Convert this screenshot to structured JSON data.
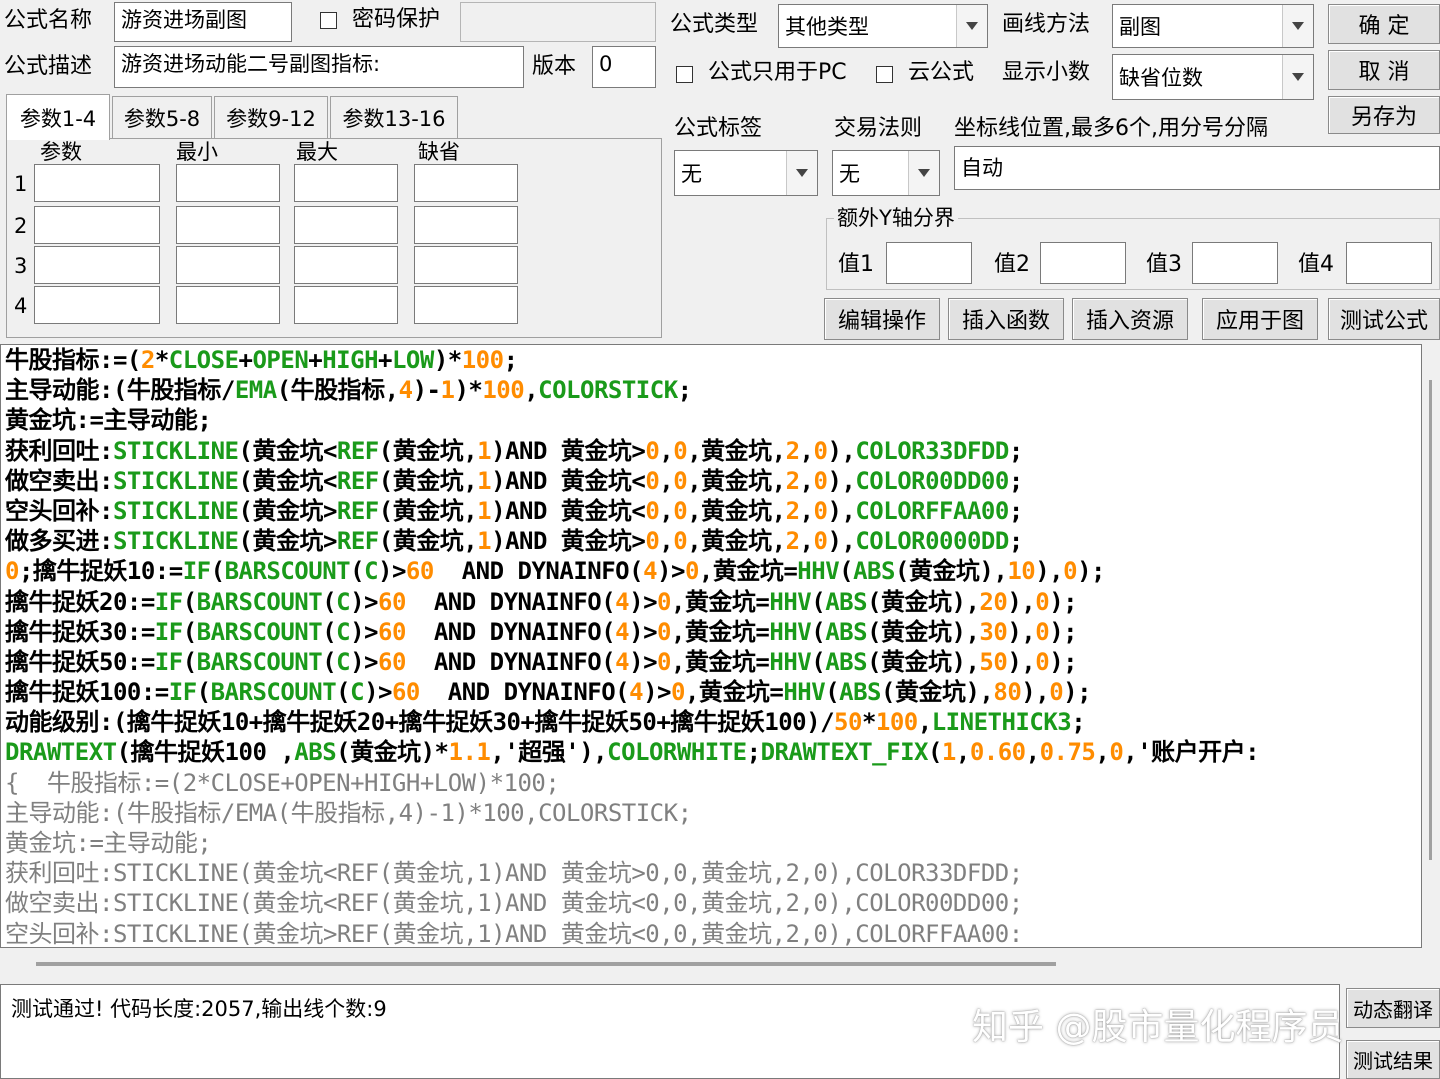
{
  "header": {
    "name_label": "公式名称",
    "name_value": "游资进场副图",
    "password_label": "密码保护",
    "password_checked": false,
    "desc_label": "公式描述",
    "desc_value": "游资进场动能二号副图指标:",
    "version_label": "版本",
    "version_value": "0",
    "type_label": "公式类型",
    "type_value": "其他类型",
    "draw_label": "画线方法",
    "draw_value": "副图",
    "pc_only_label": "公式只用于PC",
    "pc_only_checked": false,
    "cloud_label": "云公式",
    "cloud_checked": false,
    "decimals_label": "显示小数",
    "decimals_value": "缺省位数"
  },
  "buttons": {
    "ok": "确 定",
    "cancel": "取 消",
    "save_as": "另存为",
    "edit_ops": "编辑操作",
    "insert_func": "插入函数",
    "insert_res": "插入资源",
    "apply_chart": "应用于图",
    "test_formula": "测试公式",
    "translate": "动态翻译",
    "test_result": "测试结果"
  },
  "tabs": [
    "参数1-4",
    "参数5-8",
    "参数9-12",
    "参数13-16"
  ],
  "params": {
    "col_headers": [
      "参数",
      "最小",
      "最大",
      "缺省"
    ],
    "rows": [
      "1",
      "2",
      "3",
      "4"
    ]
  },
  "right_panel": {
    "tag_label": "公式标签",
    "tag_value": "无",
    "rule_label": "交易法则",
    "rule_value": "无",
    "axis_label": "坐标线位置,最多6个,用分号分隔",
    "axis_value": "自动",
    "yaxis_group": "额外Y轴分界",
    "v1": "值1",
    "v2": "值2",
    "v3": "值3",
    "v4": "值4"
  },
  "code_lines": [
    [
      [
        "t",
        "牛股指标:=("
      ],
      [
        "n",
        "2"
      ],
      [
        "t",
        "*"
      ],
      [
        "f",
        "CLOSE"
      ],
      [
        "t",
        "+"
      ],
      [
        "f",
        "OPEN"
      ],
      [
        "t",
        "+"
      ],
      [
        "f",
        "HIGH"
      ],
      [
        "t",
        "+"
      ],
      [
        "f",
        "LOW"
      ],
      [
        "t",
        ")*"
      ],
      [
        "n",
        "100"
      ],
      [
        "t",
        ";"
      ]
    ],
    [
      [
        "t",
        "主导动能:(牛股指标/"
      ],
      [
        "f",
        "EMA"
      ],
      [
        "t",
        "(牛股指标,"
      ],
      [
        "n",
        "4"
      ],
      [
        "t",
        ")-"
      ],
      [
        "n",
        "1"
      ],
      [
        "t",
        ")*"
      ],
      [
        "n",
        "100"
      ],
      [
        "t",
        ","
      ],
      [
        "f",
        "COLORSTICK"
      ],
      [
        "t",
        ";"
      ]
    ],
    [
      [
        "t",
        "黄金坑:=主导动能;"
      ]
    ],
    [
      [
        "t",
        "获利回吐:"
      ],
      [
        "f",
        "STICKLINE"
      ],
      [
        "t",
        "(黄金坑<"
      ],
      [
        "f",
        "REF"
      ],
      [
        "t",
        "(黄金坑,"
      ],
      [
        "n",
        "1"
      ],
      [
        "t",
        ")AND 黄金坑>"
      ],
      [
        "n",
        "0"
      ],
      [
        "t",
        ","
      ],
      [
        "n",
        "0"
      ],
      [
        "t",
        ",黄金坑,"
      ],
      [
        "n",
        "2"
      ],
      [
        "t",
        ","
      ],
      [
        "n",
        "0"
      ],
      [
        "t",
        "),"
      ],
      [
        "f",
        "COLOR33DFDD"
      ],
      [
        "t",
        ";"
      ]
    ],
    [
      [
        "t",
        "做空卖出:"
      ],
      [
        "f",
        "STICKLINE"
      ],
      [
        "t",
        "(黄金坑<"
      ],
      [
        "f",
        "REF"
      ],
      [
        "t",
        "(黄金坑,"
      ],
      [
        "n",
        "1"
      ],
      [
        "t",
        ")AND 黄金坑<"
      ],
      [
        "n",
        "0"
      ],
      [
        "t",
        ","
      ],
      [
        "n",
        "0"
      ],
      [
        "t",
        ",黄金坑,"
      ],
      [
        "n",
        "2"
      ],
      [
        "t",
        ","
      ],
      [
        "n",
        "0"
      ],
      [
        "t",
        "),"
      ],
      [
        "f",
        "COLOR00DD00"
      ],
      [
        "t",
        ";"
      ]
    ],
    [
      [
        "t",
        "空头回补:"
      ],
      [
        "f",
        "STICKLINE"
      ],
      [
        "t",
        "(黄金坑>"
      ],
      [
        "f",
        "REF"
      ],
      [
        "t",
        "(黄金坑,"
      ],
      [
        "n",
        "1"
      ],
      [
        "t",
        ")AND 黄金坑<"
      ],
      [
        "n",
        "0"
      ],
      [
        "t",
        ","
      ],
      [
        "n",
        "0"
      ],
      [
        "t",
        ",黄金坑,"
      ],
      [
        "n",
        "2"
      ],
      [
        "t",
        ","
      ],
      [
        "n",
        "0"
      ],
      [
        "t",
        "),"
      ],
      [
        "f",
        "COLORFFAA00"
      ],
      [
        "t",
        ";"
      ]
    ],
    [
      [
        "t",
        "做多买进:"
      ],
      [
        "f",
        "STICKLINE"
      ],
      [
        "t",
        "(黄金坑>"
      ],
      [
        "f",
        "REF"
      ],
      [
        "t",
        "(黄金坑,"
      ],
      [
        "n",
        "1"
      ],
      [
        "t",
        ")AND 黄金坑>"
      ],
      [
        "n",
        "0"
      ],
      [
        "t",
        ","
      ],
      [
        "n",
        "0"
      ],
      [
        "t",
        ",黄金坑,"
      ],
      [
        "n",
        "2"
      ],
      [
        "t",
        ","
      ],
      [
        "n",
        "0"
      ],
      [
        "t",
        "),"
      ],
      [
        "f",
        "COLOR0000DD"
      ],
      [
        "t",
        ";"
      ]
    ],
    [
      [
        "n",
        "0"
      ],
      [
        "t",
        ";擒牛捉妖10:="
      ],
      [
        "f",
        "IF"
      ],
      [
        "t",
        "("
      ],
      [
        "f",
        "BARSCOUNT"
      ],
      [
        "t",
        "("
      ],
      [
        "f",
        "C"
      ],
      [
        "t",
        ")>"
      ],
      [
        "n",
        "60"
      ],
      [
        "t",
        "  AND DYNAINFO("
      ],
      [
        "n",
        "4"
      ],
      [
        "t",
        ")>"
      ],
      [
        "n",
        "0"
      ],
      [
        "t",
        ",黄金坑="
      ],
      [
        "f",
        "HHV"
      ],
      [
        "t",
        "("
      ],
      [
        "f",
        "ABS"
      ],
      [
        "t",
        "(黄金坑),"
      ],
      [
        "n",
        "10"
      ],
      [
        "t",
        "),"
      ],
      [
        "n",
        "0"
      ],
      [
        "t",
        ");"
      ]
    ],
    [
      [
        "t",
        "擒牛捉妖20:="
      ],
      [
        "f",
        "IF"
      ],
      [
        "t",
        "("
      ],
      [
        "f",
        "BARSCOUNT"
      ],
      [
        "t",
        "("
      ],
      [
        "f",
        "C"
      ],
      [
        "t",
        ")>"
      ],
      [
        "n",
        "60"
      ],
      [
        "t",
        "  AND DYNAINFO("
      ],
      [
        "n",
        "4"
      ],
      [
        "t",
        ")>"
      ],
      [
        "n",
        "0"
      ],
      [
        "t",
        ",黄金坑="
      ],
      [
        "f",
        "HHV"
      ],
      [
        "t",
        "("
      ],
      [
        "f",
        "ABS"
      ],
      [
        "t",
        "(黄金坑),"
      ],
      [
        "n",
        "20"
      ],
      [
        "t",
        "),"
      ],
      [
        "n",
        "0"
      ],
      [
        "t",
        ");"
      ]
    ],
    [
      [
        "t",
        "擒牛捉妖30:="
      ],
      [
        "f",
        "IF"
      ],
      [
        "t",
        "("
      ],
      [
        "f",
        "BARSCOUNT"
      ],
      [
        "t",
        "("
      ],
      [
        "f",
        "C"
      ],
      [
        "t",
        ")>"
      ],
      [
        "n",
        "60"
      ],
      [
        "t",
        "  AND DYNAINFO("
      ],
      [
        "n",
        "4"
      ],
      [
        "t",
        ")>"
      ],
      [
        "n",
        "0"
      ],
      [
        "t",
        ",黄金坑="
      ],
      [
        "f",
        "HHV"
      ],
      [
        "t",
        "("
      ],
      [
        "f",
        "ABS"
      ],
      [
        "t",
        "(黄金坑),"
      ],
      [
        "n",
        "30"
      ],
      [
        "t",
        "),"
      ],
      [
        "n",
        "0"
      ],
      [
        "t",
        ");"
      ]
    ],
    [
      [
        "t",
        "擒牛捉妖50:="
      ],
      [
        "f",
        "IF"
      ],
      [
        "t",
        "("
      ],
      [
        "f",
        "BARSCOUNT"
      ],
      [
        "t",
        "("
      ],
      [
        "f",
        "C"
      ],
      [
        "t",
        ")>"
      ],
      [
        "n",
        "60"
      ],
      [
        "t",
        "  AND DYNAINFO("
      ],
      [
        "n",
        "4"
      ],
      [
        "t",
        ")>"
      ],
      [
        "n",
        "0"
      ],
      [
        "t",
        ",黄金坑="
      ],
      [
        "f",
        "HHV"
      ],
      [
        "t",
        "("
      ],
      [
        "f",
        "ABS"
      ],
      [
        "t",
        "(黄金坑),"
      ],
      [
        "n",
        "50"
      ],
      [
        "t",
        "),"
      ],
      [
        "n",
        "0"
      ],
      [
        "t",
        ");"
      ]
    ],
    [
      [
        "t",
        "擒牛捉妖100:="
      ],
      [
        "f",
        "IF"
      ],
      [
        "t",
        "("
      ],
      [
        "f",
        "BARSCOUNT"
      ],
      [
        "t",
        "("
      ],
      [
        "f",
        "C"
      ],
      [
        "t",
        ")>"
      ],
      [
        "n",
        "60"
      ],
      [
        "t",
        "  AND DYNAINFO("
      ],
      [
        "n",
        "4"
      ],
      [
        "t",
        ")>"
      ],
      [
        "n",
        "0"
      ],
      [
        "t",
        ",黄金坑="
      ],
      [
        "f",
        "HHV"
      ],
      [
        "t",
        "("
      ],
      [
        "f",
        "ABS"
      ],
      [
        "t",
        "(黄金坑),"
      ],
      [
        "n",
        "80"
      ],
      [
        "t",
        "),"
      ],
      [
        "n",
        "0"
      ],
      [
        "t",
        ");"
      ]
    ],
    [
      [
        "t",
        "动能级别:(擒牛捉妖10+擒牛捉妖20+擒牛捉妖30+擒牛捉妖50+擒牛捉妖100)/"
      ],
      [
        "n",
        "50"
      ],
      [
        "t",
        "*"
      ],
      [
        "n",
        "100"
      ],
      [
        "t",
        ","
      ],
      [
        "f",
        "LINETHICK3"
      ],
      [
        "t",
        ";"
      ]
    ],
    [
      [
        "f",
        "DRAWTEXT"
      ],
      [
        "t",
        "(擒牛捉妖100 ,"
      ],
      [
        "f",
        "ABS"
      ],
      [
        "t",
        "(黄金坑)*"
      ],
      [
        "n",
        "1.1"
      ],
      [
        "t",
        ",'超强'),"
      ],
      [
        "f",
        "COLORWHITE"
      ],
      [
        "t",
        ";"
      ],
      [
        "f",
        "DRAWTEXT_FIX"
      ],
      [
        "t",
        "("
      ],
      [
        "n",
        "1"
      ],
      [
        "t",
        ","
      ],
      [
        "n",
        "0.60"
      ],
      [
        "t",
        ","
      ],
      [
        "n",
        "0.75"
      ],
      [
        "t",
        ","
      ],
      [
        "n",
        "0"
      ],
      [
        "t",
        ",'账户开户:"
      ]
    ],
    [
      [
        "c",
        "{  牛股指标:=(2*CLOSE+OPEN+HIGH+LOW)*100;"
      ]
    ],
    [
      [
        "c",
        "主导动能:(牛股指标/EMA(牛股指标,4)-1)*100,COLORSTICK;"
      ]
    ],
    [
      [
        "c",
        "黄金坑:=主导动能;"
      ]
    ],
    [
      [
        "c",
        "获利回吐:STICKLINE(黄金坑<REF(黄金坑,1)AND 黄金坑>0,0,黄金坑,2,0),COLOR33DFDD;"
      ]
    ],
    [
      [
        "c",
        "做空卖出:STICKLINE(黄金坑<REF(黄金坑,1)AND 黄金坑<0,0,黄金坑,2,0),COLOR00DD00;"
      ]
    ],
    [
      [
        "c",
        "空头回补:STICKLINE(黄金坑>REF(黄金坑,1)AND 黄金坑<0,0,黄金坑,2,0),COLORFFAA00:"
      ]
    ]
  ],
  "status": {
    "message": "测试通过! 代码长度:2057,输出线个数:9"
  },
  "watermark": "知乎 @股市量化程序员",
  "colors": {
    "function": "#1a9a1a",
    "number": "#ff8c00",
    "comment": "#808080"
  }
}
